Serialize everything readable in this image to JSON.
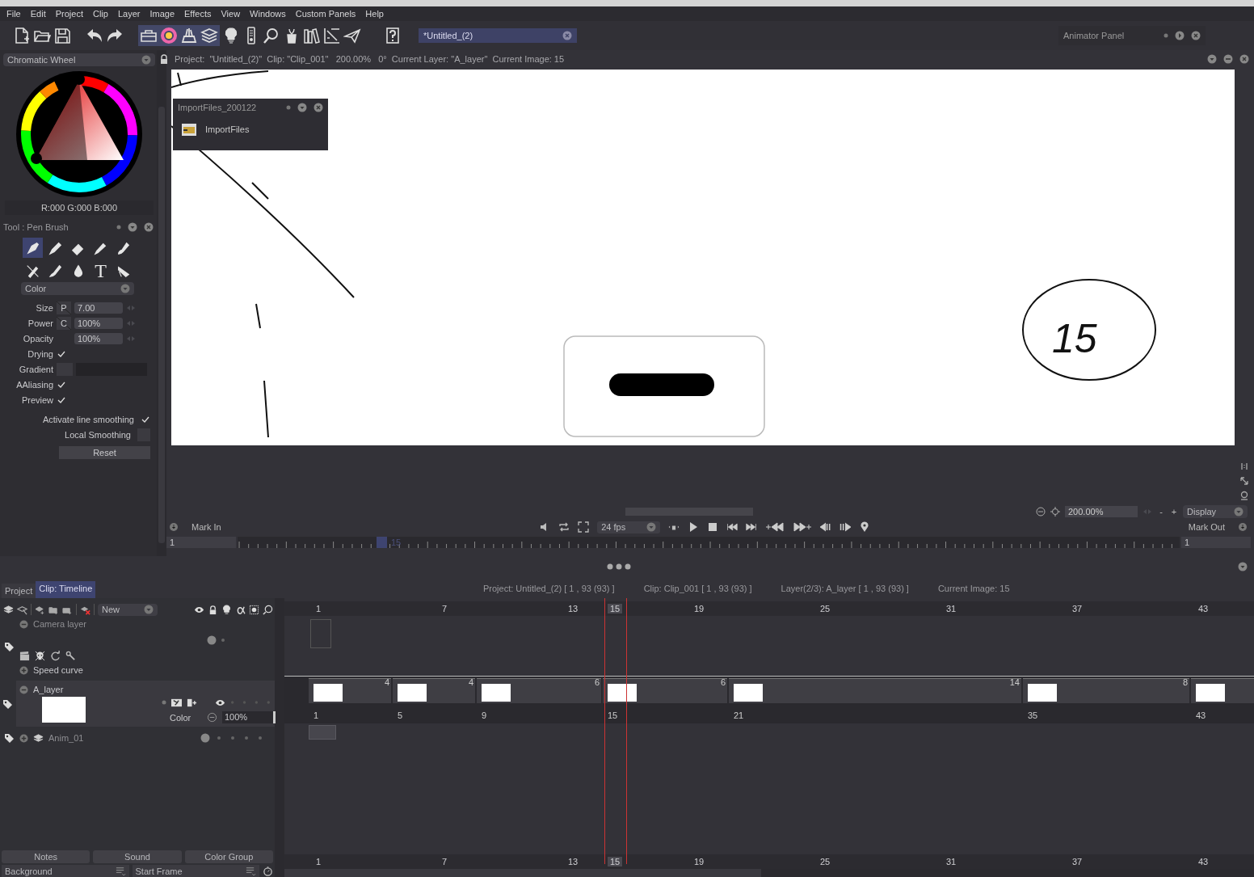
{
  "menu": [
    "File",
    "Edit",
    "Project",
    "Clip",
    "Layer",
    "Image",
    "Effects",
    "View",
    "Windows",
    "Custom Panels",
    "Help"
  ],
  "document_tab": {
    "title": "*Untitled_(2)"
  },
  "animator_panel": {
    "title": "Animator Panel"
  },
  "color_panel": {
    "mode": "Chromatic Wheel",
    "rgb": "R:000 G:000 B:000"
  },
  "tool_panel": {
    "title": "Tool : Pen Brush",
    "tools": [
      {
        "kind": "pen",
        "selected": true
      },
      {
        "kind": "pencil",
        "selected": false
      },
      {
        "kind": "eraser",
        "selected": false
      },
      {
        "kind": "marker",
        "selected": false
      },
      {
        "kind": "tube",
        "selected": false
      },
      {
        "kind": "cutter",
        "selected": false
      },
      {
        "kind": "brush",
        "selected": false
      },
      {
        "kind": "drop",
        "selected": false
      },
      {
        "kind": "text",
        "glyph": "T",
        "selected": false
      },
      {
        "kind": "knife",
        "selected": false
      }
    ],
    "mode": "Color",
    "settings": [
      {
        "kind": "field",
        "label": "Size",
        "prefix": "P",
        "value": "7.00"
      },
      {
        "kind": "field",
        "label": "Power",
        "prefix": "C",
        "value": "100%"
      },
      {
        "kind": "field",
        "label": "Opacity",
        "value": "100%"
      },
      {
        "kind": "check",
        "label": "Drying",
        "checked": true
      },
      {
        "kind": "swatch",
        "label": "Gradient"
      },
      {
        "kind": "check",
        "label": "AAliasing",
        "checked": true
      },
      {
        "kind": "check",
        "label": "Preview",
        "checked": true
      }
    ],
    "smoothing": [
      {
        "label": "Activate line smoothing",
        "checked": true
      },
      {
        "label": "Local Smoothing",
        "checked": false
      }
    ],
    "reset": "Reset"
  },
  "viewer": {
    "info": "Project:  \"Untitled_(2)\"  Clip: \"Clip_001\"   200.00%   0°  Current Layer: \"A_layer\"  Current Image: 15",
    "popup": {
      "title": "ImportFiles_200122",
      "item": "ImportFiles"
    },
    "canvas": {
      "sketch_label": "15"
    },
    "zoom": "200.00%",
    "zoom_minus": "-",
    "zoom_plus": "+",
    "display": "Display",
    "mark_in": "Mark In",
    "mark_out": "Mark Out",
    "fps": "24 fps",
    "in_frame": "1",
    "out_frame": "1",
    "current_frame": "15"
  },
  "timeline": {
    "tabs": [
      {
        "label": "Project",
        "selected": false
      },
      {
        "label": "Clip: Timeline",
        "selected": true
      }
    ],
    "info": [
      "Project: Untitled_(2) [ 1 , 93  (93) ]",
      "Clip: Clip_001 [ 1 , 93  (93) ]",
      "Layer(2/3): A_layer [ 1 , 93  (93) ]",
      "Current Image: 15"
    ],
    "new_menu": "New",
    "ruler": [
      {
        "label": "1",
        "current": false
      },
      {
        "label": "7",
        "current": false
      },
      {
        "label": "13",
        "current": false
      },
      {
        "label": "15",
        "current": true
      },
      {
        "label": "19",
        "current": false
      },
      {
        "label": "25",
        "current": false
      },
      {
        "label": "31",
        "current": false
      },
      {
        "label": "37",
        "current": false
      },
      {
        "label": "43",
        "current": false
      }
    ],
    "ruler_bottom": [
      {
        "label": "1",
        "current": false
      },
      {
        "label": "7",
        "current": false
      },
      {
        "label": "13",
        "current": false
      },
      {
        "label": "15",
        "current": true
      },
      {
        "label": "19",
        "current": false
      },
      {
        "label": "25",
        "current": false
      },
      {
        "label": "31",
        "current": false
      },
      {
        "label": "37",
        "current": false
      },
      {
        "label": "43",
        "current": false
      }
    ],
    "camera_layer": "Camera layer",
    "speed_curve": "Speed curve",
    "layer": {
      "name": "A_layer",
      "blend": "Color",
      "opacity": "100%",
      "visible": true
    },
    "group": {
      "name": "Anim_01"
    },
    "cells": [
      {
        "start": "1",
        "hold": "4"
      },
      {
        "start": "5",
        "hold": "4"
      },
      {
        "start": "9",
        "hold": "6"
      },
      {
        "start": "15",
        "hold": "6"
      },
      {
        "start": "21",
        "hold": "14"
      },
      {
        "start": "35",
        "hold": "8"
      },
      {
        "start": "43"
      }
    ],
    "buttons": [
      "Notes",
      "Sound",
      "Color Group"
    ],
    "fields": [
      "Background",
      "Start Frame"
    ]
  }
}
